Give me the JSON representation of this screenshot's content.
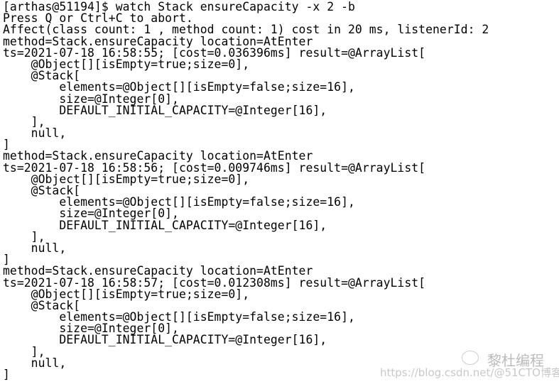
{
  "terminal": {
    "lines": [
      "[arthas@51194]$ watch Stack ensureCapacity -x 2 -b",
      "Press Q or Ctrl+C to abort.",
      "Affect(class count: 1 , method count: 1) cost in 20 ms, listenerId: 2",
      "method=Stack.ensureCapacity location=AtEnter",
      "ts=2021-07-18 16:58:55; [cost=0.036396ms] result=@ArrayList[",
      "    @Object[][isEmpty=true;size=0],",
      "    @Stack[",
      "        elements=@Object[][isEmpty=false;size=16],",
      "        size=@Integer[0],",
      "        DEFAULT_INITIAL_CAPACITY=@Integer[16],",
      "    ],",
      "    null,",
      "]",
      "method=Stack.ensureCapacity location=AtEnter",
      "ts=2021-07-18 16:58:56; [cost=0.009746ms] result=@ArrayList[",
      "    @Object[][isEmpty=true;size=0],",
      "    @Stack[",
      "        elements=@Object[][isEmpty=false;size=16],",
      "        size=@Integer[0],",
      "        DEFAULT_INITIAL_CAPACITY=@Integer[16],",
      "    ],",
      "    null,",
      "]",
      "method=Stack.ensureCapacity location=AtEnter",
      "ts=2021-07-18 16:58:57; [cost=0.012308ms] result=@ArrayList[",
      "    @Object[][isEmpty=true;size=0],",
      "    @Stack[",
      "        elements=@Object[][isEmpty=false;size=16],",
      "        size=@Integer[0],",
      "        DEFAULT_INITIAL_CAPACITY=@Integer[16],",
      "    ],",
      "    null,",
      "]"
    ]
  },
  "watermark": {
    "channel": "黎杜编程",
    "source": "https://blog.csdn.net/@51CTO博客",
    "icon": "wechat-icon"
  }
}
